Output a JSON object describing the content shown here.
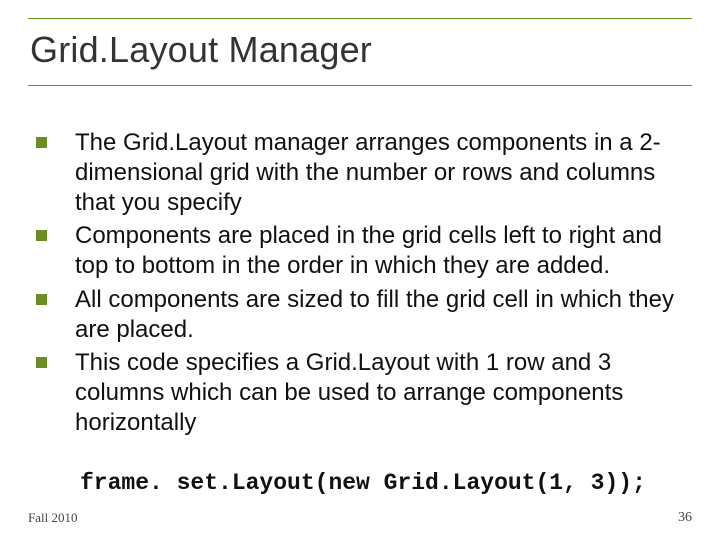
{
  "title": "Grid.Layout Manager",
  "bullets": [
    "The Grid.Layout manager arranges components in a 2-dimensional grid with the number or rows and columns that you specify",
    "Components are placed in the grid cells left to right and top to bottom in the order in which they are added.",
    "All components are sized to fill the grid cell in which they are placed.",
    "This code specifies a Grid.Layout with 1 row and 3 columns which can be used to arrange components horizontally"
  ],
  "code": "frame. set.Layout(new Grid.Layout(1, 3));",
  "footer": {
    "left": "Fall 2010",
    "right": "36"
  }
}
